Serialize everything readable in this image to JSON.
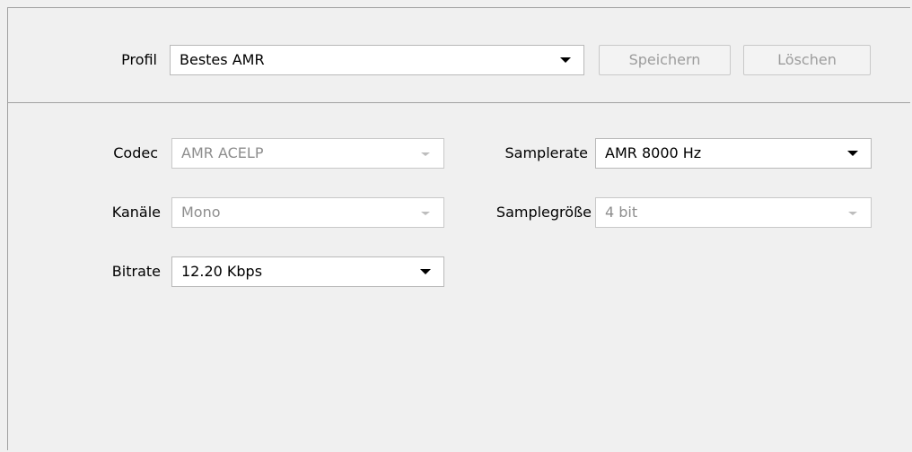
{
  "profile": {
    "label": "Profil",
    "value": "Bestes AMR",
    "save_button": "Speichern",
    "delete_button": "Löschen"
  },
  "settings": {
    "codec": {
      "label": "Codec",
      "value": "AMR ACELP"
    },
    "channels": {
      "label": "Kanäle",
      "value": "Mono"
    },
    "bitrate": {
      "label": "Bitrate",
      "value": "12.20 Kbps"
    },
    "samplerate": {
      "label": "Samplerate",
      "value": "AMR 8000 Hz"
    },
    "samplesize": {
      "label": "Samplegröße",
      "value": "4 bit"
    }
  },
  "icons": {
    "dropdown": "chevron-down-icon"
  }
}
